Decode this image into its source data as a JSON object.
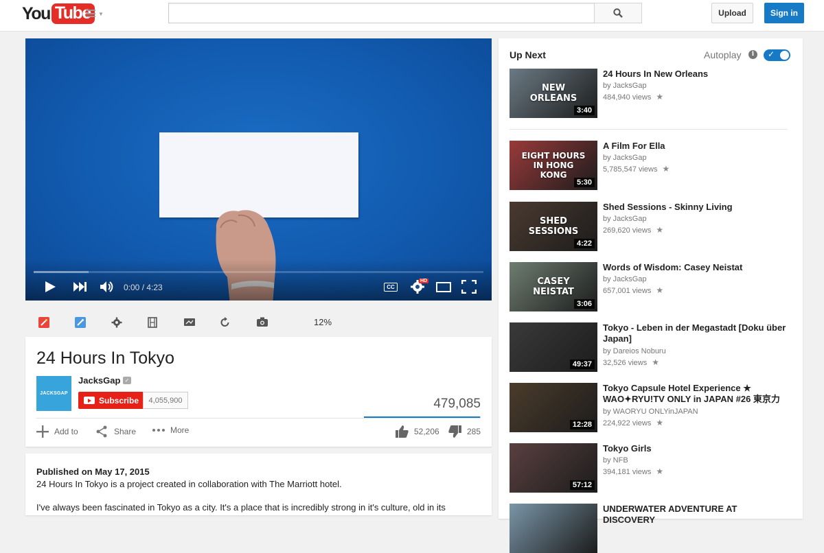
{
  "masthead": {
    "logo_you": "You",
    "logo_tube": "Tube",
    "search_value": "",
    "upload_label": "Upload",
    "signin_label": "Sign in"
  },
  "player": {
    "time": "0:00 / 4:23",
    "cc_label": "CC",
    "hd_label": "HD",
    "progress_fraction": 0,
    "buffered_fraction": 0.12
  },
  "extension_bar": {
    "zoom": "12%"
  },
  "video": {
    "title": "24 Hours In Tokyo",
    "channel_name": "JacksGap",
    "channel_avatar_text": "JACKSGAP",
    "subscribe_label": "Subscribe",
    "subscriber_count": "4,055,900",
    "view_count": "479,085",
    "add_to_label": "Add to",
    "share_label": "Share",
    "more_label": "More",
    "likes": "52,206",
    "dislikes": "285",
    "like_fraction": 0.995
  },
  "description": {
    "published": "Published on May 17, 2015",
    "line1": "24 Hours In Tokyo is a project created in collaboration with The Marriott hotel.",
    "line2": "I've always been fascinated in Tokyo as a city. It's a place that is incredibly strong in it's culture, old in its"
  },
  "sidebar": {
    "upnext_label": "Up Next",
    "autoplay_label": "Autoplay",
    "autoplay_info": "i",
    "autoplay_on": true,
    "videos": [
      {
        "title": "24 Hours In New Orleans",
        "channel": "by JacksGap",
        "views": "484,940 views",
        "duration": "3:40",
        "thumb_text": "NEW ORLEANS",
        "color": "#6b7a84"
      },
      {
        "title": "A Film For Ella",
        "channel": "by JacksGap",
        "views": "5,785,547 views",
        "duration": "5:30",
        "thumb_text": "EIGHT HOURS IN HONG KONG",
        "color": "#9a3a3a"
      },
      {
        "title": "Shed Sessions - Skinny Living",
        "channel": "by JacksGap",
        "views": "269,620 views",
        "duration": "4:22",
        "thumb_text": "SHED SESSIONS",
        "color": "#4a3a30"
      },
      {
        "title": "Words of Wisdom: Casey Neistat",
        "channel": "by JacksGap",
        "views": "657,001 views",
        "duration": "3:06",
        "thumb_text": "CASEY NEISTAT",
        "color": "#6e7d70"
      },
      {
        "title": "Tokyo - Leben in der Megastadt [Doku über Japan]",
        "channel": "by Dareios Noburu",
        "views": "32,526 views",
        "duration": "49:37",
        "thumb_text": "",
        "color": "#3a3a3a"
      },
      {
        "title": "Tokyo Capsule Hotel Experience ★ WAO✦RYU!TV ONLY in JAPAN #26 東京力",
        "channel": "by WAORYU ONLYinJAPAN",
        "views": "224,922 views",
        "duration": "12:28",
        "thumb_text": "",
        "color": "#4b3c2c"
      },
      {
        "title": "Tokyo Girls",
        "channel": "by NFB",
        "views": "394,181 views",
        "duration": "57:12",
        "thumb_text": "",
        "color": "#5a4040"
      },
      {
        "title": "UNDERWATER ADVENTURE AT DISCOVERY",
        "channel": "",
        "views": "",
        "duration": "",
        "thumb_text": "",
        "color": "#7a96a8"
      }
    ]
  }
}
